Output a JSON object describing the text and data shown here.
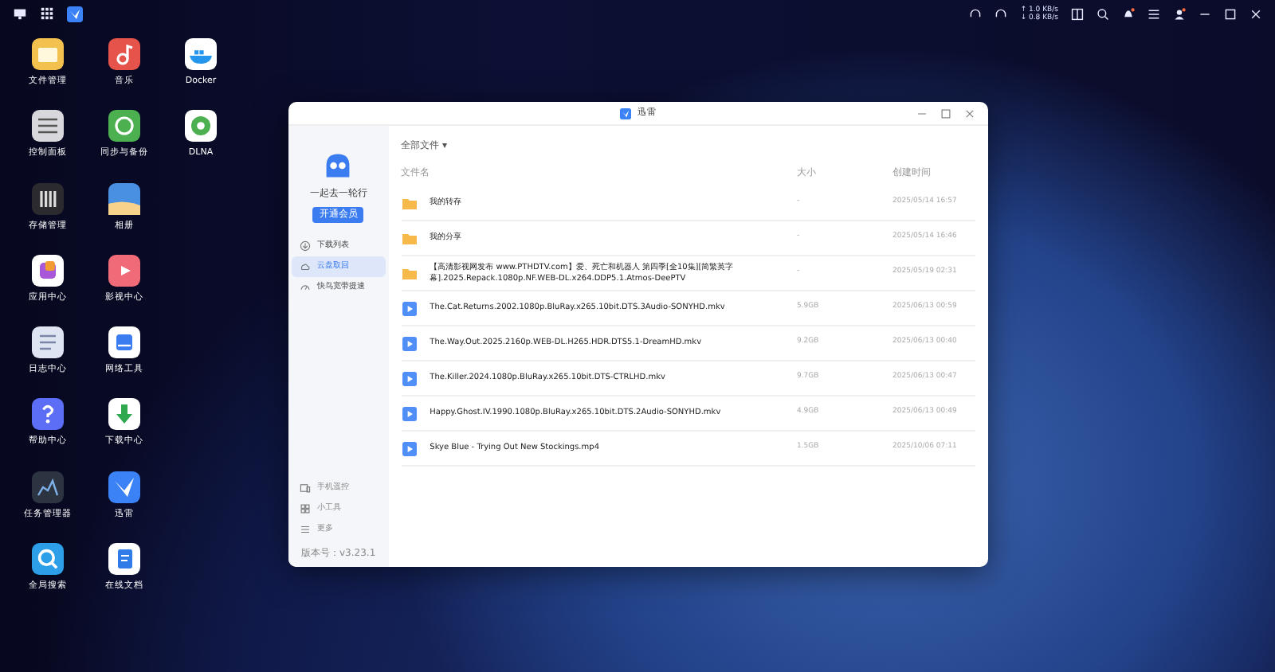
{
  "top_bar": {
    "upload_speed": "↑ 1.0 KB/s",
    "download_speed": "↓ 0.8 KB/s"
  },
  "desktop_icons": [
    {
      "label": "文件管理",
      "kind": "files"
    },
    {
      "label": "控制面板",
      "kind": "control"
    },
    {
      "label": "存储管理",
      "kind": "storage"
    },
    {
      "label": "应用中心",
      "kind": "apps"
    },
    {
      "label": "日志中心",
      "kind": "logs"
    },
    {
      "label": "帮助中心",
      "kind": "help"
    },
    {
      "label": "任务管理器",
      "kind": "tasks"
    },
    {
      "label": "全局搜索",
      "kind": "search"
    },
    {
      "label": "音乐",
      "kind": "music"
    },
    {
      "label": "同步与备份",
      "kind": "sync"
    },
    {
      "label": "相册",
      "kind": "photos"
    },
    {
      "label": "影视中心",
      "kind": "video"
    },
    {
      "label": "网络工具",
      "kind": "network"
    },
    {
      "label": "下载中心",
      "kind": "download"
    },
    {
      "label": "迅雷",
      "kind": "thunder"
    },
    {
      "label": "在线文档",
      "kind": "docs"
    },
    {
      "label": "Docker",
      "kind": "docker"
    },
    {
      "label": "DLNA",
      "kind": "dlna"
    }
  ],
  "window": {
    "title": "迅雷",
    "sidebar": {
      "user_name": "一起去一轮行",
      "vip_button": "开通会员",
      "items": [
        {
          "label": "下载列表",
          "kind": "download",
          "selected": false
        },
        {
          "label": "云盘取回",
          "kind": "cloud",
          "selected": true
        },
        {
          "label": "快鸟宽带提速",
          "kind": "speed",
          "selected": false
        }
      ],
      "bottom_items": [
        {
          "label": "手机遥控",
          "kind": "phone"
        },
        {
          "label": "小工具",
          "kind": "tools"
        },
        {
          "label": "更多",
          "kind": "more"
        }
      ],
      "version": "版本号：v3.23.1"
    },
    "filter": "全部文件",
    "filter_caret": "▾",
    "table": {
      "columns": [
        "文件名",
        "大小",
        "创建时间"
      ],
      "rows": [
        {
          "kind": "folder",
          "name": "我的转存",
          "size": "-",
          "created": "2025/05/14 16:57"
        },
        {
          "kind": "folder",
          "name": "我的分享",
          "size": "-",
          "created": "2025/05/14 16:46"
        },
        {
          "kind": "folder",
          "name": "【高清影视网发布 www.PTHDTV.com】爱、死亡和机器人 第四季[全10集][简繁英字幕].2025.Repack.1080p.NF.WEB-DL.x264.DDP5.1.Atmos-DeePTV",
          "size": "-",
          "created": "2025/05/19 02:31"
        },
        {
          "kind": "video",
          "name": "The.Cat.Returns.2002.1080p.BluRay.x265.10bit.DTS.3Audio-SONYHD.mkv",
          "size": "5.9GB",
          "created": "2025/06/13 00:59"
        },
        {
          "kind": "video",
          "name": "The.Way.Out.2025.2160p.WEB-DL.H265.HDR.DTS5.1-DreamHD.mkv",
          "size": "9.2GB",
          "created": "2025/06/13 00:40"
        },
        {
          "kind": "video",
          "name": "The.Killer.2024.1080p.BluRay.x265.10bit.DTS-CTRLHD.mkv",
          "size": "9.7GB",
          "created": "2025/06/13 00:47"
        },
        {
          "kind": "video",
          "name": "Happy.Ghost.IV.1990.1080p.BluRay.x265.10bit.DTS.2Audio-SONYHD.mkv",
          "size": "4.9GB",
          "created": "2025/06/13 00:49"
        },
        {
          "kind": "video",
          "name": "Skye Blue - Trying Out New Stockings.mp4",
          "size": "1.5GB",
          "created": "2025/10/06 07:11"
        }
      ]
    }
  }
}
